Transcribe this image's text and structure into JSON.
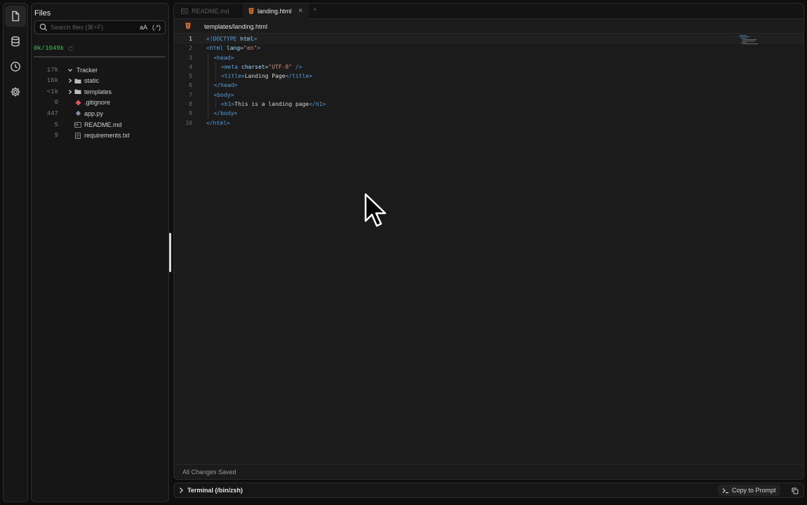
{
  "explorer": {
    "title": "Files",
    "search_placeholder": "Search files (⌘+F)",
    "match_case_label": "aA",
    "regex_label": "(.*)",
    "token_count": "0k/1049k",
    "tree": [
      {
        "size": "17k",
        "name": "Tracker",
        "kind": "folder-open"
      },
      {
        "size": "16k",
        "name": "static",
        "kind": "folder"
      },
      {
        "size": "<1k",
        "name": "templates",
        "kind": "folder"
      },
      {
        "size": "0",
        "name": ".gitignore",
        "kind": "git"
      },
      {
        "size": "447",
        "name": "app.py",
        "kind": "python"
      },
      {
        "size": "5",
        "name": "README.md",
        "kind": "markdown"
      },
      {
        "size": "9",
        "name": "requirements.txt",
        "kind": "text"
      }
    ]
  },
  "editor": {
    "tabs": [
      {
        "label": "README.md",
        "active": false
      },
      {
        "label": "landing.html",
        "active": true
      }
    ],
    "breadcrumb": "templates/landing.html",
    "code_lines": [
      {
        "n": "1",
        "indent": 0,
        "tokens": [
          {
            "t": "<!DOCTYPE ",
            "c": "t-tag"
          },
          {
            "t": "html",
            "c": "t-attr"
          },
          {
            "t": ">",
            "c": "t-tag"
          }
        ]
      },
      {
        "n": "2",
        "indent": 0,
        "tokens": [
          {
            "t": "<html ",
            "c": "t-tag"
          },
          {
            "t": "lang",
            "c": "t-attr"
          },
          {
            "t": "=",
            "c": "t-txt"
          },
          {
            "t": "\"en\"",
            "c": "t-str"
          },
          {
            "t": ">",
            "c": "t-tag"
          }
        ]
      },
      {
        "n": "3",
        "indent": 1,
        "tokens": [
          {
            "t": "<head>",
            "c": "t-tag"
          }
        ]
      },
      {
        "n": "4",
        "indent": 2,
        "tokens": [
          {
            "t": "<meta ",
            "c": "t-tag"
          },
          {
            "t": "charset",
            "c": "t-attr"
          },
          {
            "t": "=",
            "c": "t-txt"
          },
          {
            "t": "\"UTF-8\"",
            "c": "t-str"
          },
          {
            "t": " />",
            "c": "t-tag"
          }
        ]
      },
      {
        "n": "5",
        "indent": 2,
        "tokens": [
          {
            "t": "<title>",
            "c": "t-tag"
          },
          {
            "t": "Landing Page",
            "c": "t-txt"
          },
          {
            "t": "</title>",
            "c": "t-tag"
          }
        ]
      },
      {
        "n": "6",
        "indent": 1,
        "tokens": [
          {
            "t": "</head>",
            "c": "t-tag"
          }
        ]
      },
      {
        "n": "7",
        "indent": 1,
        "tokens": [
          {
            "t": "<body>",
            "c": "t-tag"
          }
        ]
      },
      {
        "n": "8",
        "indent": 2,
        "tokens": [
          {
            "t": "<h1>",
            "c": "t-tag"
          },
          {
            "t": "This is a landing page",
            "c": "t-txt"
          },
          {
            "t": "</h1>",
            "c": "t-tag"
          }
        ]
      },
      {
        "n": "9",
        "indent": 1,
        "tokens": [
          {
            "t": "</body>",
            "c": "t-tag"
          }
        ]
      },
      {
        "n": "10",
        "indent": 0,
        "tokens": [
          {
            "t": "</html>",
            "c": "t-tag"
          }
        ]
      }
    ],
    "status": "All Changes Saved"
  },
  "terminal": {
    "title": "Terminal (/bin/zsh)",
    "copy_label": "Copy to Prompt"
  },
  "colors": {
    "token_count": "#3fbf5c",
    "html_icon": "#e37933",
    "git_icon": "#e05561",
    "python_icon": "#7d8fa3"
  }
}
